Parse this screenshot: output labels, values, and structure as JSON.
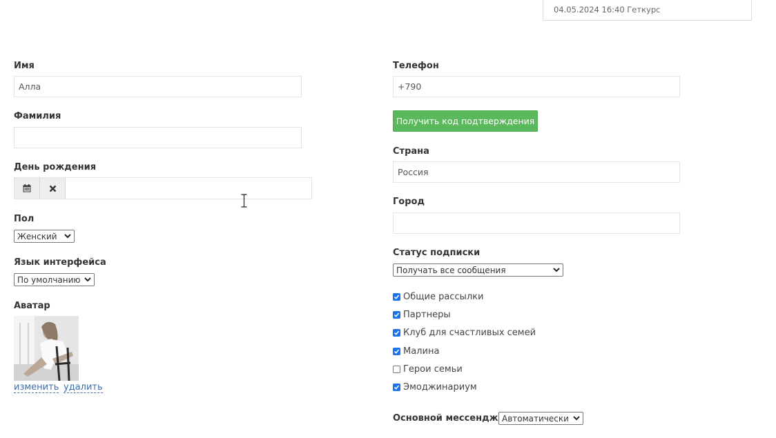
{
  "info": {
    "date_text": "04.05.2024 16:40 Геткурс"
  },
  "left": {
    "first_name": {
      "label": "Имя",
      "value": "Алла"
    },
    "last_name": {
      "label": "Фамилия",
      "value": ""
    },
    "birthday": {
      "label": "День рождения",
      "value": ""
    },
    "gender": {
      "label": "Пол",
      "value": "Женский"
    },
    "language": {
      "label": "Язык интерфейса",
      "value": "По умолчанию"
    },
    "avatar": {
      "label": "Аватар",
      "change_link": "изменить",
      "delete_link": "удалить"
    }
  },
  "right": {
    "phone": {
      "label": "Телефон",
      "value": "+790"
    },
    "get_code_button": "Получить код подтверждения",
    "country": {
      "label": "Страна",
      "value": "Россия"
    },
    "city": {
      "label": "Город",
      "value": ""
    },
    "subscription": {
      "label": "Статус подписки",
      "value": "Получать все сообщения"
    },
    "lists": [
      {
        "label": "Общие рассылки",
        "checked": true
      },
      {
        "label": "Партнеры",
        "checked": true
      },
      {
        "label": "Клуб для счастливых семей",
        "checked": true
      },
      {
        "label": "Малина",
        "checked": true
      },
      {
        "label": "Герои семьи",
        "checked": false
      },
      {
        "label": "Эмоджинариум",
        "checked": true
      }
    ],
    "messenger": {
      "label": "Основной мессенджер",
      "value": "Автоматически"
    }
  },
  "colors": {
    "button_green": "#5cb85c",
    "checkbox_blue": "#1a73e8",
    "link_blue": "#3a6fb0"
  }
}
